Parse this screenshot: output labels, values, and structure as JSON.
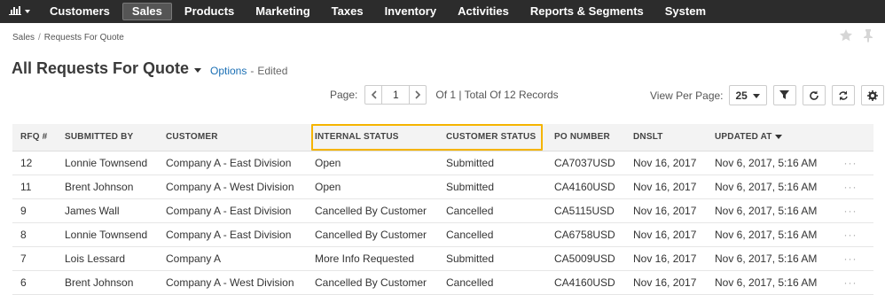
{
  "nav": {
    "items": [
      {
        "label": "Customers",
        "name": "nav-customers"
      },
      {
        "label": "Sales",
        "name": "nav-sales",
        "active": true
      },
      {
        "label": "Products",
        "name": "nav-products"
      },
      {
        "label": "Marketing",
        "name": "nav-marketing"
      },
      {
        "label": "Taxes",
        "name": "nav-taxes"
      },
      {
        "label": "Inventory",
        "name": "nav-inventory"
      },
      {
        "label": "Activities",
        "name": "nav-activities"
      },
      {
        "label": "Reports & Segments",
        "name": "nav-reports-segments"
      },
      {
        "label": "System",
        "name": "nav-system"
      }
    ]
  },
  "breadcrumb": {
    "root": "Sales",
    "sep": "/",
    "current": "Requests For Quote"
  },
  "title": "All Requests For Quote",
  "options": {
    "link": "Options",
    "sep": "-",
    "status": "Edited"
  },
  "pager": {
    "label": "Page:",
    "page": "1",
    "total": "Of 1 | Total Of 12 Records"
  },
  "view_per_page": {
    "label": "View Per Page:",
    "value": "25"
  },
  "table": {
    "headers": [
      "RFQ #",
      "SUBMITTED BY",
      "CUSTOMER",
      "INTERNAL STATUS",
      "CUSTOMER STATUS",
      "PO NUMBER",
      "DNSLT",
      "UPDATED AT",
      ""
    ],
    "rows": [
      [
        "12",
        "Lonnie Townsend",
        "Company A - East Division",
        "Open",
        "Submitted",
        "CA7037USD",
        "Nov 16, 2017",
        "Nov 6, 2017, 5:16 AM",
        "···"
      ],
      [
        "11",
        "Brent Johnson",
        "Company A - West Division",
        "Open",
        "Submitted",
        "CA4160USD",
        "Nov 16, 2017",
        "Nov 6, 2017, 5:16 AM",
        "···"
      ],
      [
        "9",
        "James Wall",
        "Company A - East Division",
        "Cancelled By Customer",
        "Cancelled",
        "CA5115USD",
        "Nov 16, 2017",
        "Nov 6, 2017, 5:16 AM",
        "···"
      ],
      [
        "8",
        "Lonnie Townsend",
        "Company A - East Division",
        "Cancelled By Customer",
        "Cancelled",
        "CA6758USD",
        "Nov 16, 2017",
        "Nov 6, 2017, 5:16 AM",
        "···"
      ],
      [
        "7",
        "Lois Lessard",
        "Company A",
        "More Info Requested",
        "Submitted",
        "CA5009USD",
        "Nov 16, 2017",
        "Nov 6, 2017, 5:16 AM",
        "···"
      ],
      [
        "6",
        "Brent Johnson",
        "Company A - West Division",
        "Cancelled By Customer",
        "Cancelled",
        "CA4160USD",
        "Nov 16, 2017",
        "Nov 6, 2017, 5:16 AM",
        "···"
      ]
    ]
  },
  "colors": {
    "nav_bg": "#2c2c2c",
    "link": "#1a6fb4",
    "highlight": "#f5b400"
  }
}
